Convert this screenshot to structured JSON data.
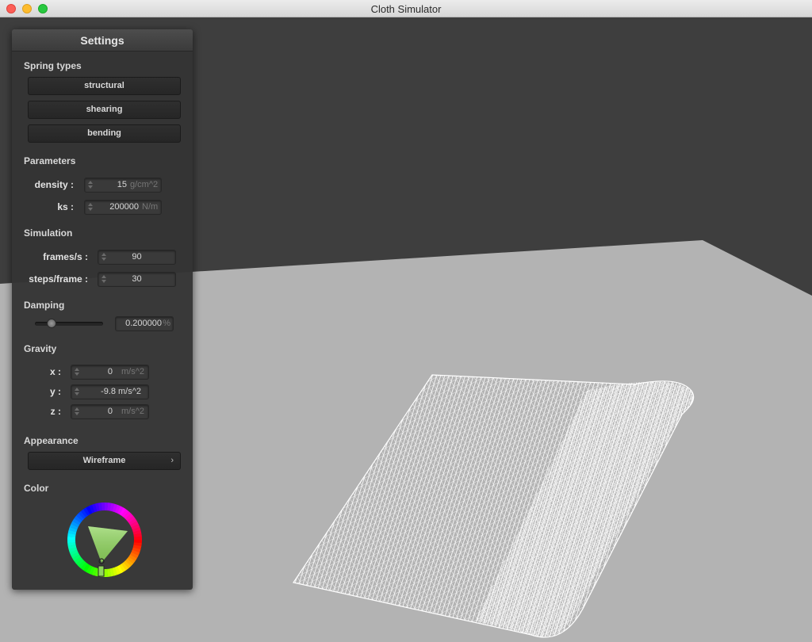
{
  "window": {
    "title": "Cloth Simulator"
  },
  "colors": {
    "background": "#3e3e3e",
    "floor": "#b3b3b3",
    "cloth": "#ffffff",
    "selected_color": "#8fd45e"
  },
  "settings": {
    "title": "Settings",
    "spring_types": {
      "label": "Spring types",
      "buttons": [
        "structural",
        "shearing",
        "bending"
      ]
    },
    "parameters": {
      "label": "Parameters",
      "density": {
        "label": "density :",
        "value": "15",
        "unit": "g/cm^2"
      },
      "ks": {
        "label": "ks :",
        "value": "200000",
        "unit": "N/m"
      }
    },
    "simulation": {
      "label": "Simulation",
      "frames": {
        "label": "frames/s :",
        "value": "90"
      },
      "steps": {
        "label": "steps/frame :",
        "value": "30"
      }
    },
    "damping": {
      "label": "Damping",
      "value": "0.200000",
      "unit": "%",
      "slider_fraction": 0.2
    },
    "gravity": {
      "label": "Gravity",
      "x": {
        "label": "x :",
        "value": "0",
        "unit": "m/s^2"
      },
      "y": {
        "label": "y :",
        "value": "-9.8",
        "unit": "m/s^2"
      },
      "z": {
        "label": "z :",
        "value": "0",
        "unit": "m/s^2"
      }
    },
    "appearance": {
      "label": "Appearance",
      "selected": "Wireframe",
      "chevron": "›"
    },
    "color": {
      "label": "Color"
    }
  }
}
